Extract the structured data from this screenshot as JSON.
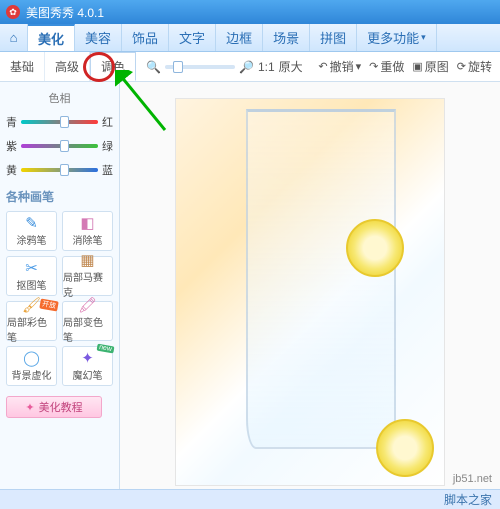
{
  "title": "美图秀秀 4.0.1",
  "menu": {
    "items": [
      "美化",
      "美容",
      "饰品",
      "文字",
      "边框",
      "场景",
      "拼图",
      "更多功能"
    ],
    "active_index": 0
  },
  "subtabs": {
    "items": [
      "基础",
      "高级",
      "调色"
    ],
    "active_index": 2
  },
  "zoom": {
    "ratio": "1:1",
    "original_label": "原大"
  },
  "tools": {
    "undo": "撤销",
    "redo": "重做",
    "original": "原图",
    "rotate": "旋转"
  },
  "color_section": {
    "label": "色相"
  },
  "sliders": [
    {
      "left": "青",
      "right": "红",
      "gradient": "linear-gradient(to right,#00c8c8,#ff3b3b)",
      "pos": 50
    },
    {
      "left": "紫",
      "right": "绿",
      "gradient": "linear-gradient(to right,#b040d8,#3bc23b)",
      "pos": 50
    },
    {
      "left": "黄",
      "right": "蓝",
      "gradient": "linear-gradient(to right,#f2d400,#2b6fe0)",
      "pos": 50
    }
  ],
  "brush_header": "各种画笔",
  "brushes": [
    {
      "name": "涂鸦笔",
      "icon": "✎",
      "color": "#3a8edc"
    },
    {
      "name": "消除笔",
      "icon": "◧",
      "color": "#d47ab5"
    },
    {
      "name": "抠图笔",
      "icon": "✂",
      "color": "#4a9ae6"
    },
    {
      "name": "局部马赛克",
      "icon": "▦",
      "color": "#c08850"
    },
    {
      "name": "局部彩色笔",
      "icon": "🖌",
      "color": "#e8a23a",
      "badge": "开放"
    },
    {
      "name": "局部变色笔",
      "icon": "🖍",
      "color": "#d86aa8"
    },
    {
      "name": "背景虚化",
      "icon": "◯",
      "color": "#5aa7e6"
    },
    {
      "name": "魔幻笔",
      "icon": "✦",
      "color": "#7a5ae0",
      "badge": "new",
      "badge_style": "green"
    }
  ],
  "tutorial_btn": "美化教程",
  "watermark": "jb51.net",
  "footer_credit": "脚本之家"
}
